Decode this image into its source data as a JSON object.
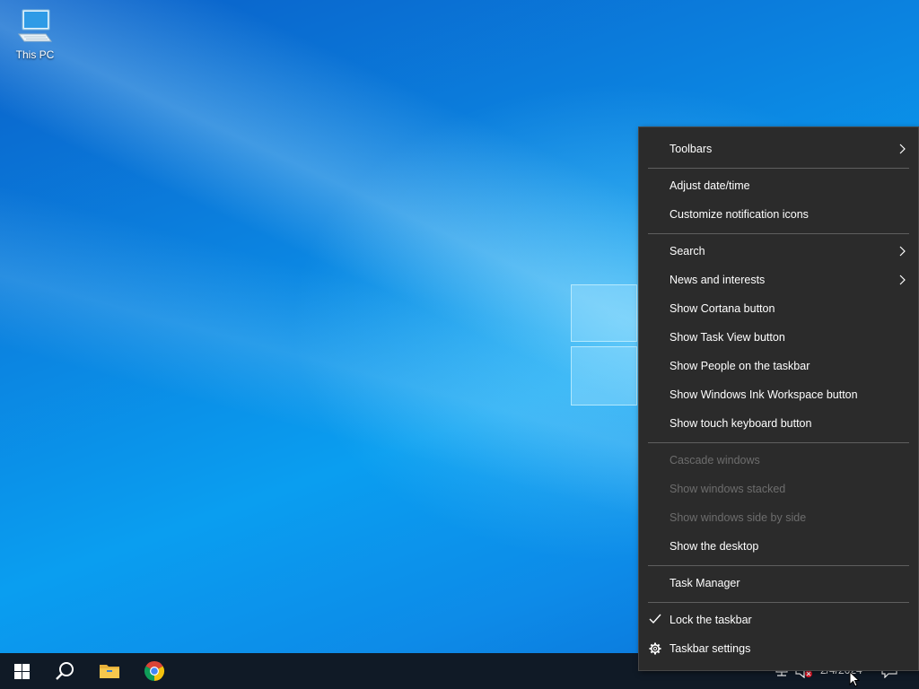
{
  "desktop": {
    "icons": [
      {
        "label": "This PC",
        "icon": "this-pc-icon"
      }
    ]
  },
  "context_menu": {
    "items": [
      {
        "label": "Toolbars",
        "submenu": true
      },
      {
        "label": "Adjust date/time"
      },
      {
        "label": "Customize notification icons"
      },
      {
        "label": "Search",
        "submenu": true
      },
      {
        "label": "News and interests",
        "submenu": true
      },
      {
        "label": "Show Cortana button"
      },
      {
        "label": "Show Task View button"
      },
      {
        "label": "Show People on the taskbar"
      },
      {
        "label": "Show Windows Ink Workspace button"
      },
      {
        "label": "Show touch keyboard button"
      },
      {
        "label": "Cascade windows",
        "disabled": true
      },
      {
        "label": "Show windows stacked",
        "disabled": true
      },
      {
        "label": "Show windows side by side",
        "disabled": true
      },
      {
        "label": "Show the desktop"
      },
      {
        "label": "Task Manager"
      },
      {
        "label": "Lock the taskbar",
        "checked": true,
        "icon": "checkmark-icon"
      },
      {
        "label": "Taskbar settings",
        "icon": "gear-icon"
      }
    ]
  },
  "taskbar": {
    "buttons": [
      {
        "icon": "windows-start-icon"
      },
      {
        "icon": "search-icon"
      },
      {
        "icon": "file-explorer-icon"
      },
      {
        "icon": "chrome-icon"
      }
    ],
    "tray": {
      "network_icon": "network-disconnected-icon",
      "volume_icon": "volume-muted-icon",
      "clock": "2/4/2024",
      "notification_icon": "action-center-icon"
    }
  },
  "colors": {
    "menu_background": "#2b2b2b",
    "menu_text": "#ffffff",
    "menu_disabled_text": "#6d6d6d",
    "taskbar_background": "#101a26",
    "desktop_blue": "#0a78d7"
  }
}
